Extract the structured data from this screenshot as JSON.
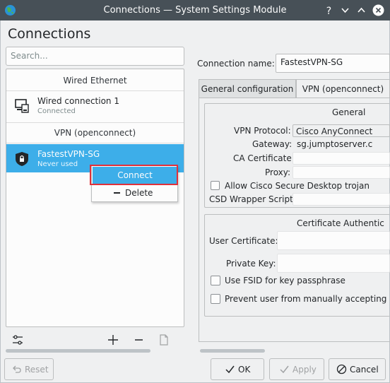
{
  "window": {
    "title": "Connections — System Settings Module"
  },
  "page": {
    "heading": "Connections"
  },
  "search": {
    "placeholder": "Search..."
  },
  "connection_list": {
    "sections": [
      {
        "header": "Wired Ethernet",
        "items": [
          {
            "name": "Wired connection 1",
            "status": "Connected",
            "icon": "wired-network-icon"
          }
        ]
      },
      {
        "header": "VPN (openconnect)",
        "items": [
          {
            "name": "FastestVPN-SG",
            "status": "Never used",
            "icon": "vpn-shield-icon",
            "selected": true
          }
        ]
      }
    ]
  },
  "context_menu": {
    "connect_label": "Connect",
    "delete_label": "Delete"
  },
  "details": {
    "connection_name_label": "Connection name:",
    "connection_name_value": "FastestVPN-SG",
    "tabs": [
      {
        "label": "General configuration",
        "active": false
      },
      {
        "label": "VPN (openconnect)",
        "active": true
      }
    ],
    "general_group": {
      "title": "General",
      "vpn_protocol_label": "VPN Protocol:",
      "vpn_protocol_value": "Cisco AnyConnect",
      "gateway_label": "Gateway:",
      "gateway_value": "sg.jumptoserver.c",
      "ca_certificate_label": "CA Certificate:",
      "proxy_label": "Proxy:",
      "allow_trojan_label": "Allow Cisco Secure Desktop trojan",
      "csd_script_label": "CSD Wrapper Script:"
    },
    "cert_group": {
      "title": "Certificate Authentic",
      "user_certificate_label": "User Certificate:",
      "private_key_label": "Private Key:",
      "fsid_label": "Use FSID for key passphrase",
      "prevent_label": "Prevent user from manually accepting"
    }
  },
  "buttons": {
    "reset": "Reset",
    "ok": "OK",
    "apply": "Apply",
    "cancel": "Cancel"
  },
  "colors": {
    "titlebar": "#475057",
    "selection": "#3daee9",
    "highlight_border": "#e0303a",
    "background": "#eff0f1"
  }
}
